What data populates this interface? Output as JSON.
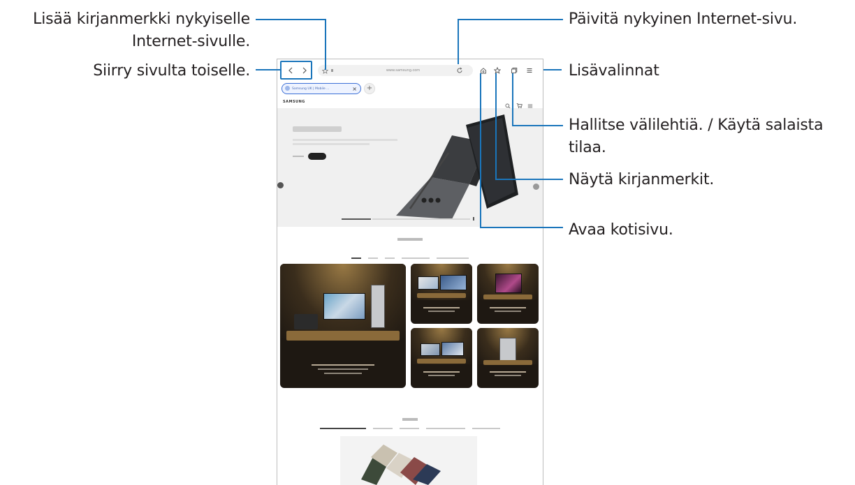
{
  "callouts": {
    "add_bookmark_line1": "Lisää kirjanmerkki nykyiselle",
    "add_bookmark_line2": "Internet-sivulle.",
    "navigate": "Siirry sivulta toiselle.",
    "refresh": "Päivitä nykyinen Internet-sivu.",
    "more_options": "Lisävalinnat",
    "manage_tabs_line1": "Hallitse välilehtiä. / Käytä salaista",
    "manage_tabs_line2": "tilaa.",
    "show_bookmarks": "Näytä kirjanmerkit.",
    "open_home": "Avaa kotisivu."
  },
  "browser": {
    "url": "www.samsung.com",
    "tab_title": "Samsung UK | Mobile ...",
    "site_logo": "SAMSUNG"
  },
  "icons": {
    "back": "chevron-left-icon",
    "forward": "chevron-right-icon",
    "bookmark_add": "star-icon",
    "refresh": "refresh-icon",
    "home": "home-icon",
    "bookmarks": "star-icon",
    "tabs": "tabs-icon",
    "menu": "menu-icon"
  },
  "colors": {
    "callout_line": "#1a75bb",
    "text": "#231f20"
  }
}
